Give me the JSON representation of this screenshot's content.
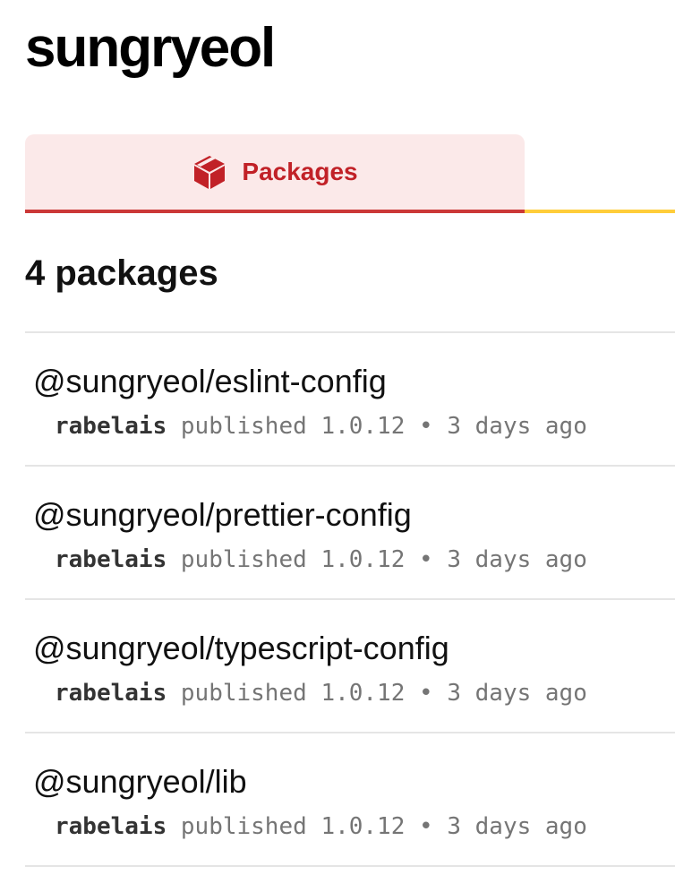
{
  "org": {
    "title": "sungryeol"
  },
  "tabs": [
    {
      "label": "Packages",
      "icon": "package-icon",
      "active": true
    }
  ],
  "colors": {
    "accent": "#cb3837",
    "accent_text": "#c12127",
    "tab_active_bg": "#fbe9e9",
    "tab_rest_border": "#ffcd3a"
  },
  "packages_heading": "4 packages",
  "packages": [
    {
      "name": "@sungryeol/eslint-config",
      "publisher": "rabelais",
      "published_label": "published",
      "version": "1.0.12",
      "separator": "•",
      "time": "3 days ago"
    },
    {
      "name": "@sungryeol/prettier-config",
      "publisher": "rabelais",
      "published_label": "published",
      "version": "1.0.12",
      "separator": "•",
      "time": "3 days ago"
    },
    {
      "name": "@sungryeol/typescript-config",
      "publisher": "rabelais",
      "published_label": "published",
      "version": "1.0.12",
      "separator": "•",
      "time": "3 days ago"
    },
    {
      "name": "@sungryeol/lib",
      "publisher": "rabelais",
      "published_label": "published",
      "version": "1.0.12",
      "separator": "•",
      "time": "3 days ago"
    }
  ]
}
